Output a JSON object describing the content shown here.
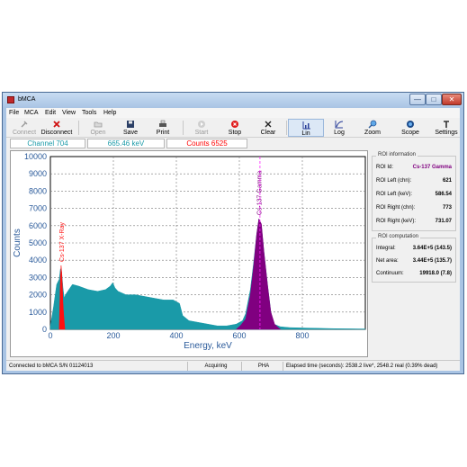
{
  "window": {
    "title": "bMCA",
    "min_glyph": "—",
    "max_glyph": "□",
    "close_glyph": "✕"
  },
  "menu": [
    "File",
    "MCA",
    "Edit",
    "View",
    "Tools",
    "Help"
  ],
  "toolbar": [
    {
      "label": "Connect",
      "icon": "connect-icon",
      "enabled": false
    },
    {
      "label": "Disconnect",
      "icon": "disconnect-icon",
      "enabled": true
    },
    {
      "label": "Open",
      "icon": "open-icon",
      "enabled": false
    },
    {
      "label": "Save",
      "icon": "save-icon",
      "enabled": true
    },
    {
      "label": "Print",
      "icon": "print-icon",
      "enabled": true
    },
    {
      "label": "Start",
      "icon": "start-icon",
      "enabled": false
    },
    {
      "label": "Stop",
      "icon": "stop-icon",
      "enabled": true
    },
    {
      "label": "Clear",
      "icon": "clear-icon",
      "enabled": true
    },
    {
      "label": "Lin",
      "icon": "lin-icon",
      "enabled": true,
      "active": true
    },
    {
      "label": "Log",
      "icon": "log-icon",
      "enabled": true
    },
    {
      "label": "Zoom",
      "icon": "zoom-icon",
      "enabled": true
    },
    {
      "label": "Scope",
      "icon": "scope-icon",
      "enabled": true
    },
    {
      "label": "Settings",
      "icon": "settings-icon",
      "enabled": true
    }
  ],
  "info": {
    "channel": "Channel 704",
    "energy": "665.46 keV",
    "counts": "Counts 6525"
  },
  "colors": {
    "spectrum": "#1a9aa8",
    "roi_xray": "#ff1010",
    "roi_gamma": "#800080",
    "channel_text": "#1a9aa8",
    "counts_text": "#ff0000",
    "roi_id_text": "#800080"
  },
  "roi_info": {
    "title": "ROI information",
    "rows": [
      {
        "label": "ROI Id:",
        "value": "Cs-137 Gamma"
      },
      {
        "label": "ROI Left (chn):",
        "value": "621"
      },
      {
        "label": "ROI Left (keV):",
        "value": "586.54"
      },
      {
        "label": "ROI Right (chn):",
        "value": "773"
      },
      {
        "label": "ROI Right (keV):",
        "value": "731.07"
      }
    ]
  },
  "roi_comp": {
    "title": "ROI computation",
    "rows": [
      {
        "label": "Integral:",
        "value": "3.64E+5 (143.5)"
      },
      {
        "label": "Net area:",
        "value": "3.44E+5 (135.7)"
      },
      {
        "label": "Continuum:",
        "value": "19918.0 (7.8)"
      }
    ]
  },
  "status": {
    "connection": "Connected to bMCA S/N 01124013",
    "state": "Acquiring",
    "mode": "PHA",
    "elapsed": "Elapsed time (seconds): 2538.2 live*, 2548.2 real (0.39% dead)"
  },
  "chart_data": {
    "type": "area",
    "xlabel": "Energy, keV",
    "ylabel": "Counts",
    "xlim": [
      0,
      1000
    ],
    "ylim": [
      0,
      10000
    ],
    "x_ticks": [
      0,
      200,
      400,
      600,
      800
    ],
    "y_ticks": [
      0,
      1000,
      2000,
      3000,
      4000,
      5000,
      6000,
      7000,
      8000,
      9000,
      10000
    ],
    "grid": true,
    "series": [
      {
        "name": "spectrum",
        "x": [
          0,
          10,
          20,
          28,
          32,
          36,
          40,
          44,
          48,
          55,
          70,
          90,
          120,
          150,
          175,
          190,
          198,
          205,
          215,
          240,
          270,
          300,
          330,
          360,
          390,
          410,
          420,
          440,
          470,
          500,
          530,
          560,
          590,
          610,
          620,
          635,
          645,
          655,
          662,
          670,
          678,
          690,
          700,
          710,
          730,
          760,
          800,
          850,
          900,
          950,
          1000
        ],
        "y": [
          200,
          1300,
          2600,
          2900,
          3500,
          3300,
          2400,
          1800,
          2000,
          2200,
          2600,
          2500,
          2300,
          2200,
          2300,
          2500,
          2700,
          2400,
          2200,
          2000,
          2000,
          1900,
          1800,
          1700,
          1700,
          1500,
          800,
          500,
          400,
          300,
          200,
          200,
          300,
          500,
          900,
          2300,
          3800,
          5500,
          6400,
          6000,
          4500,
          2500,
          1000,
          300,
          150,
          100,
          80,
          60,
          40,
          30,
          20
        ]
      }
    ],
    "rois": [
      {
        "label": "Cs-137 X-Ray",
        "x": [
          28,
          32,
          34,
          36,
          38,
          40,
          42,
          46
        ],
        "y": [
          0,
          3000,
          3700,
          3300,
          2500,
          1500,
          900,
          0
        ]
      },
      {
        "label": "Cs-137 Gamma",
        "x": [
          590,
          605,
          620,
          635,
          645,
          655,
          662,
          670,
          678,
          690,
          700,
          712,
          725,
          731
        ],
        "y": [
          0,
          250,
          600,
          2000,
          3600,
          5500,
          6400,
          6100,
          4500,
          2500,
          1000,
          300,
          80,
          0
        ]
      }
    ],
    "cursor_x": 665.46
  }
}
